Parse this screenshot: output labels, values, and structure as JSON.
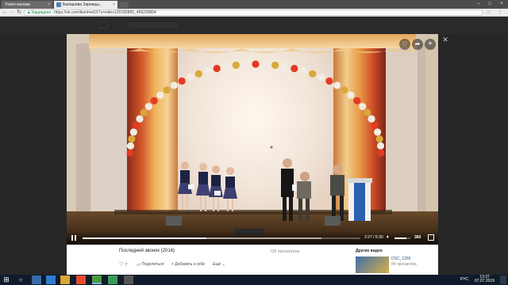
{
  "browser": {
    "tabs": [
      {
        "label": "Yкоел ватажа",
        "active": false
      },
      {
        "label": "Балашова Зарницы...",
        "active": true
      }
    ],
    "security_label": "Защищено",
    "url": "https://vk.com/tkerimet167z=video120182865_456239054"
  },
  "player": {
    "time_elapsed": "2:27",
    "time_total": "5:30",
    "quality": "360",
    "progress_fraction": 0.445,
    "buffer_fraction": 0.86,
    "volume_fraction": 0.75
  },
  "info": {
    "title": "Последний звонок (2016)",
    "views": "720 просмотров",
    "likes": "7",
    "share_label": "Поделиться",
    "add_label": "Добавить к себе",
    "more_label": "Ещё",
    "other_videos_label": "Другие видео",
    "related": {
      "title": "DSC_1266",
      "views": "84 просмотра"
    }
  },
  "taskbar": {
    "language": "РУС",
    "time": "13:37",
    "date": "07.07.2019"
  },
  "colors": {
    "tabstrip": "#4d4d4d",
    "page_bg": "#262626",
    "taskbar": "#0f1b2a",
    "balloon_red": "#e53a22",
    "balloon_white": "#f2ece2",
    "balloon_gold": "#d8a83a",
    "vk_blue": "#5181b8"
  },
  "icons": [
    "lock-icon",
    "star-icon",
    "menu-icon",
    "heart-icon",
    "share-icon",
    "plus-icon",
    "close-icon",
    "play-icon",
    "volume-icon",
    "fullscreen-icon",
    "windows-icon",
    "search-icon"
  ]
}
